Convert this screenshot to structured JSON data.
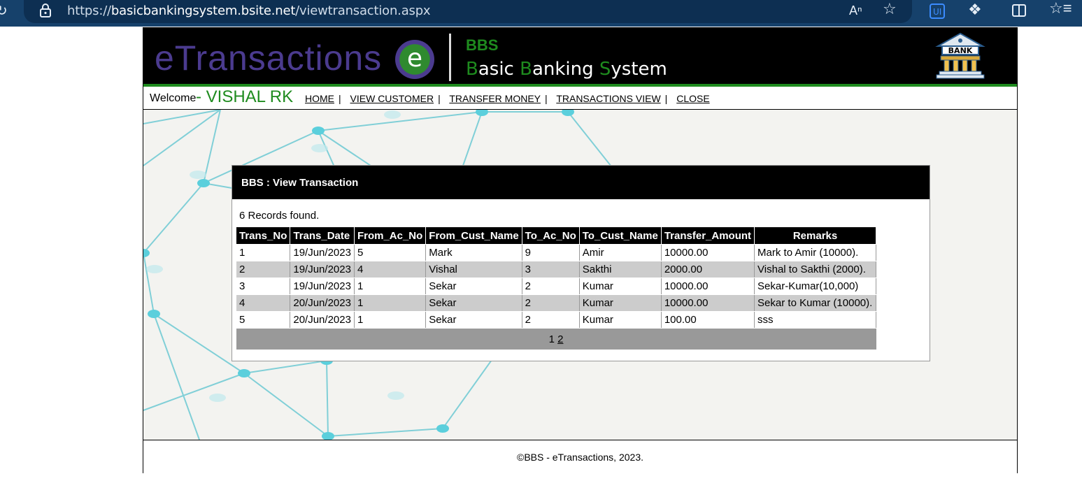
{
  "browser": {
    "url_scheme": "https://",
    "url_host": "basicbankingsystem.bsite.net",
    "url_path": "/viewtransaction.aspx",
    "icons": [
      "refresh-icon",
      "lock-icon",
      "read-aloud-icon",
      "favorite-star-icon",
      "extension-ui-icon",
      "extensions-icon",
      "split-screen-icon",
      "favorites-icon"
    ]
  },
  "banner": {
    "logo_text": "eTransactions",
    "logo_letter": "e",
    "short_name": "BBS",
    "long_name_parts": [
      {
        "initial": "B",
        "rest": "asic "
      },
      {
        "initial": "B",
        "rest": "anking "
      },
      {
        "initial": "S",
        "rest": "ystem"
      }
    ],
    "bank_icon_label": "BANK",
    "colors": {
      "purple": "#4b3b8f",
      "green": "#1e8b1e"
    }
  },
  "nav": {
    "welcome": "Welcome",
    "user": "- VISHAL RK",
    "links": [
      "HOME",
      "VIEW CUSTOMER",
      "TRANSFER MONEY",
      "TRANSACTIONS VIEW",
      "CLOSE"
    ],
    "separator": "|"
  },
  "panel": {
    "title": "BBS : View Transaction",
    "count_text": "6 Records found.",
    "columns": [
      "Trans_No",
      "Trans_Date",
      "From_Ac_No",
      "From_Cust_Name",
      "To_Ac_No",
      "To_Cust_Name",
      "Transfer_Amount",
      "Remarks"
    ],
    "rows": [
      [
        "1",
        "19/Jun/2023",
        "5",
        "Mark",
        "9",
        "Amir",
        "10000.00",
        "Mark to Amir (10000)."
      ],
      [
        "2",
        "19/Jun/2023",
        "4",
        "Vishal",
        "3",
        "Sakthi",
        "2000.00",
        "Vishal to Sakthi (2000)."
      ],
      [
        "3",
        "19/Jun/2023",
        "1",
        "Sekar",
        "2",
        "Kumar",
        "10000.00",
        "Sekar-Kumar(10,000)"
      ],
      [
        "4",
        "20/Jun/2023",
        "1",
        "Sekar",
        "2",
        "Kumar",
        "10000.00",
        "Sekar to Kumar (10000)."
      ],
      [
        "5",
        "20/Jun/2023",
        "1",
        "Sekar",
        "2",
        "Kumar",
        "100.00",
        "sss"
      ]
    ],
    "pager": {
      "current": "1",
      "other": "2"
    }
  },
  "footer": {
    "text": "©BBS - eTransactions, 2023."
  }
}
